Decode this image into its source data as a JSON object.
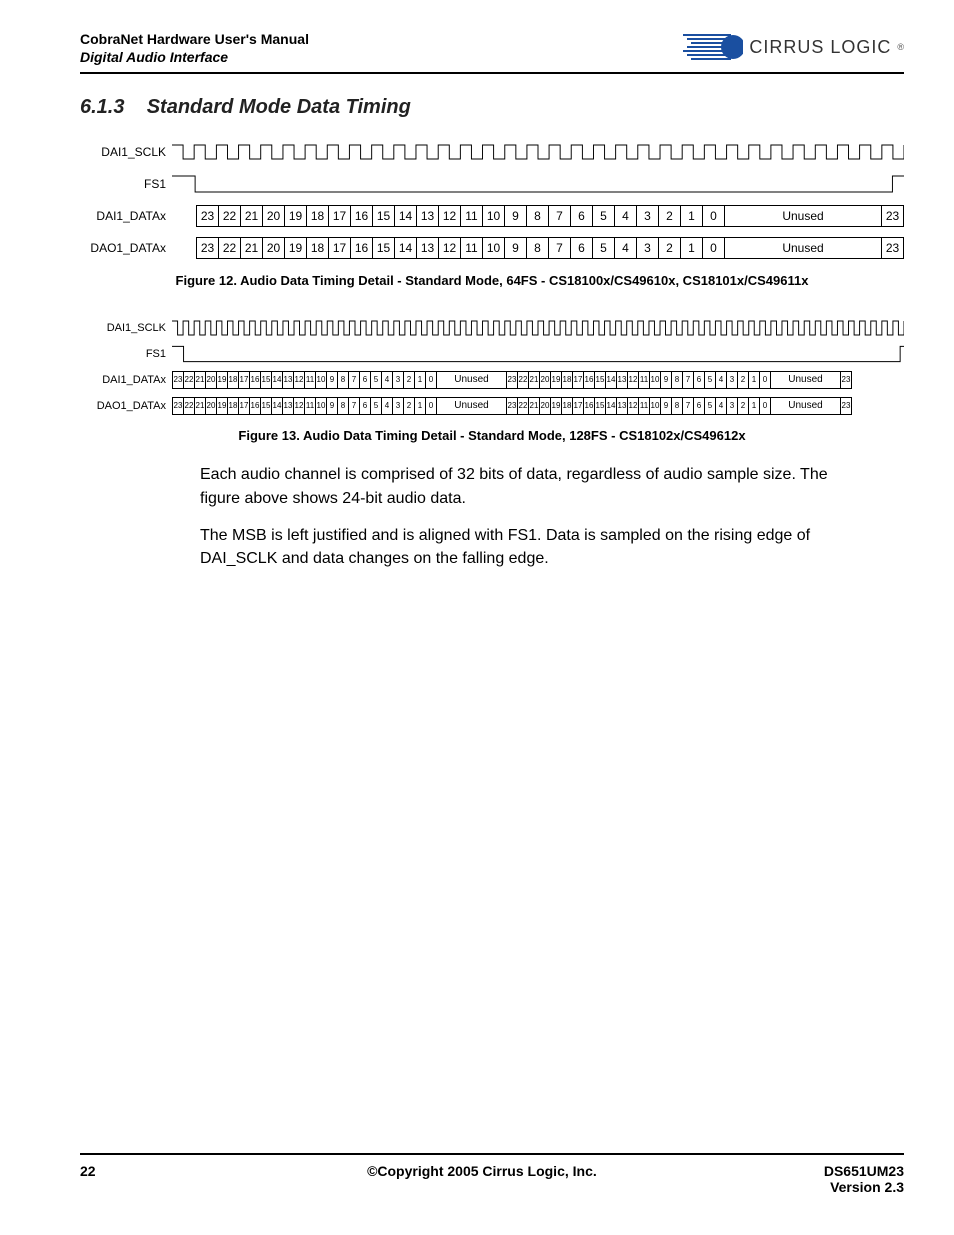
{
  "header": {
    "manual_title": "CobraNet Hardware User's Manual",
    "section_title": "Digital Audio Interface",
    "logo_text": "CIRRUS LOGIC"
  },
  "section": {
    "number": "6.1.3",
    "title": "Standard Mode Data Timing"
  },
  "figure12": {
    "signals": {
      "sclk": "DAI1_SCLK",
      "fs": "FS1",
      "dai": "DAI1_DATAx",
      "dao": "DAO1_DATAx"
    },
    "bits": [
      "23",
      "22",
      "21",
      "20",
      "19",
      "18",
      "17",
      "16",
      "15",
      "14",
      "13",
      "12",
      "11",
      "10",
      "9",
      "8",
      "7",
      "6",
      "5",
      "4",
      "3",
      "2",
      "1",
      "0"
    ],
    "unused": "Unused",
    "trailing_bit": "23",
    "caption": "Figure 12. Audio Data Timing Detail - Standard Mode, 64FS - CS18100x/CS49610x, CS18101x/CS49611x"
  },
  "figure13": {
    "signals": {
      "sclk": "DAI1_SCLK",
      "fs": "FS1",
      "dai": "DAI1_DATAx",
      "dao": "DAO1_DATAx"
    },
    "bits": [
      "23",
      "22",
      "21",
      "20",
      "19",
      "18",
      "17",
      "16",
      "15",
      "14",
      "13",
      "12",
      "11",
      "10",
      "9",
      "8",
      "7",
      "6",
      "5",
      "4",
      "3",
      "2",
      "1",
      "0"
    ],
    "unused": "Unused",
    "trailing_bit": "23",
    "caption": "Figure 13. Audio Data Timing Detail - Standard Mode, 128FS - CS18102x/CS49612x"
  },
  "body": {
    "para1": "Each audio channel is comprised of 32 bits of data, regardless of audio sample size. The figure above shows 24-bit audio data.",
    "para2": "The MSB is left justified and is aligned with FS1. Data is sampled on the rising edge of DAI_SCLK and data changes on the falling edge."
  },
  "footer": {
    "page": "22",
    "copyright": "©Copyright 2005 Cirrus Logic, Inc.",
    "doc_id": "DS651UM23",
    "version": "Version 2.3"
  }
}
